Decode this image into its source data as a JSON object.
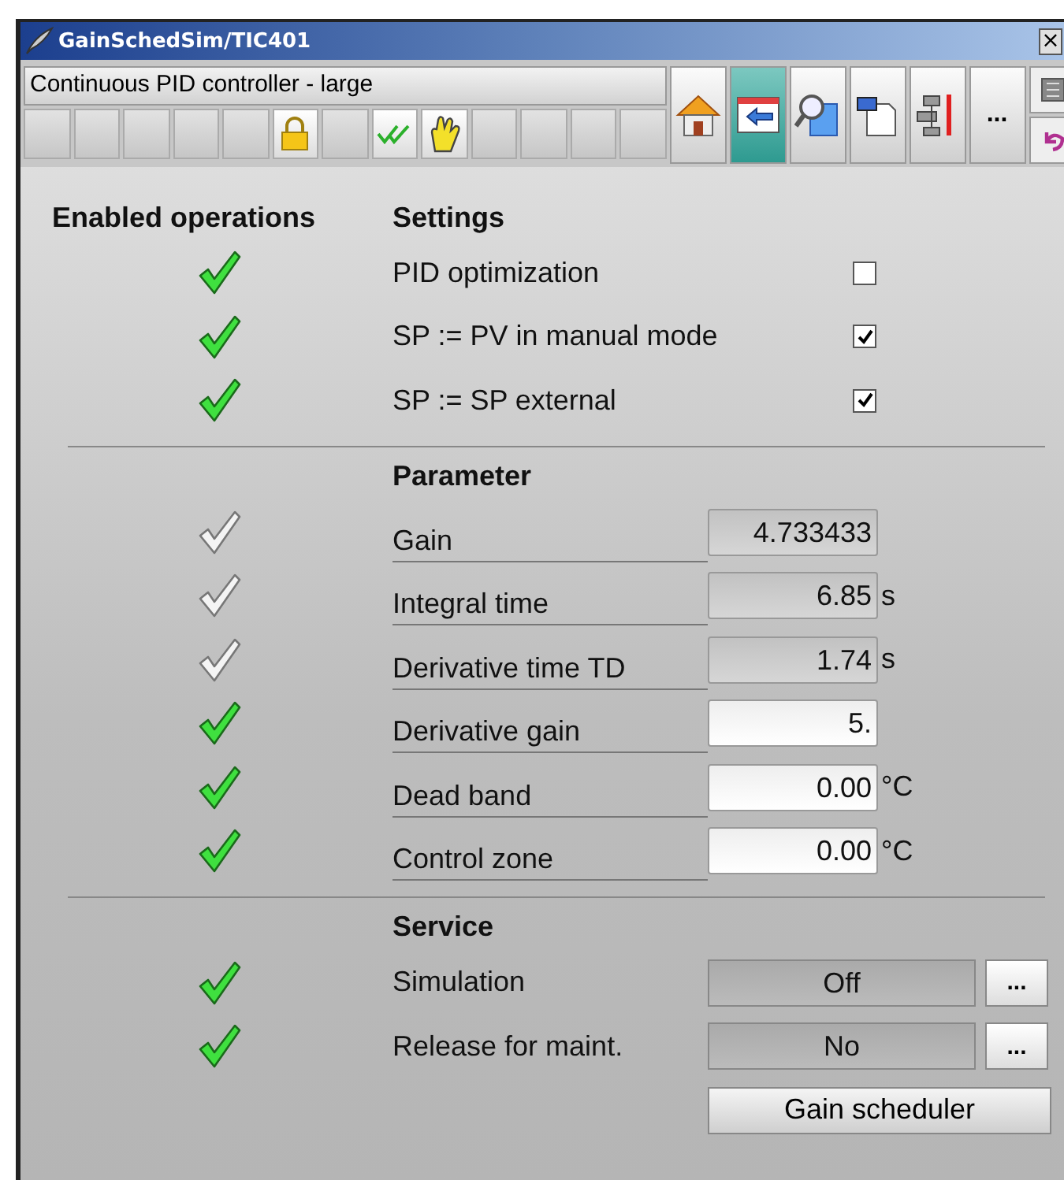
{
  "window": {
    "title": "GainSchedSim/TIC401",
    "close": "×"
  },
  "header": {
    "title": "Continuous PID controller - large",
    "slots": [
      {
        "kind": "empty"
      },
      {
        "kind": "empty"
      },
      {
        "kind": "empty"
      },
      {
        "kind": "empty"
      },
      {
        "kind": "empty"
      },
      {
        "kind": "lock"
      },
      {
        "kind": "empty"
      },
      {
        "kind": "check"
      },
      {
        "kind": "hand"
      },
      {
        "kind": "empty"
      },
      {
        "kind": "empty"
      },
      {
        "kind": "empty"
      },
      {
        "kind": "empty"
      }
    ],
    "tools": [
      {
        "kind": "home",
        "selected": false
      },
      {
        "kind": "back",
        "selected": true
      },
      {
        "kind": "zoom",
        "selected": false
      },
      {
        "kind": "faceplate",
        "selected": false
      },
      {
        "kind": "loop",
        "selected": false
      },
      {
        "kind": "more",
        "label": "...",
        "selected": false
      }
    ],
    "side": [
      {
        "kind": "panel"
      },
      {
        "kind": "undo"
      }
    ]
  },
  "enabled_header": "Enabled operations",
  "settings": {
    "title": "Settings",
    "items": [
      {
        "label": "PID optimization",
        "enabled": true,
        "checked": false
      },
      {
        "label": "SP := PV in manual mode",
        "enabled": true,
        "checked": true
      },
      {
        "label": "SP := SP external",
        "enabled": true,
        "checked": true
      }
    ]
  },
  "parameters": {
    "title": "Parameter",
    "items": [
      {
        "label": "Gain",
        "value": "4.733433",
        "enabled": false
      },
      {
        "label": "Integral time",
        "value": "6.85",
        "unit": "s",
        "enabled": false
      },
      {
        "label": "Derivative time TD",
        "value": "1.74",
        "unit": "s",
        "enabled": false
      },
      {
        "label": "Derivative gain",
        "value": "5.",
        "enabled": true
      },
      {
        "label": "Dead band",
        "value": "0.00",
        "unit": "°C",
        "enabled": true
      },
      {
        "label": "Control zone",
        "value": "0.00",
        "unit": "°C",
        "enabled": true
      }
    ]
  },
  "service": {
    "title": "Service",
    "items": [
      {
        "label": "Simulation",
        "value": "Off",
        "more": "...",
        "enabled": true
      },
      {
        "label": "Release for maint.",
        "value": "No",
        "more": "...",
        "enabled": true
      }
    ],
    "buttons": [
      "Gain scheduler"
    ]
  }
}
